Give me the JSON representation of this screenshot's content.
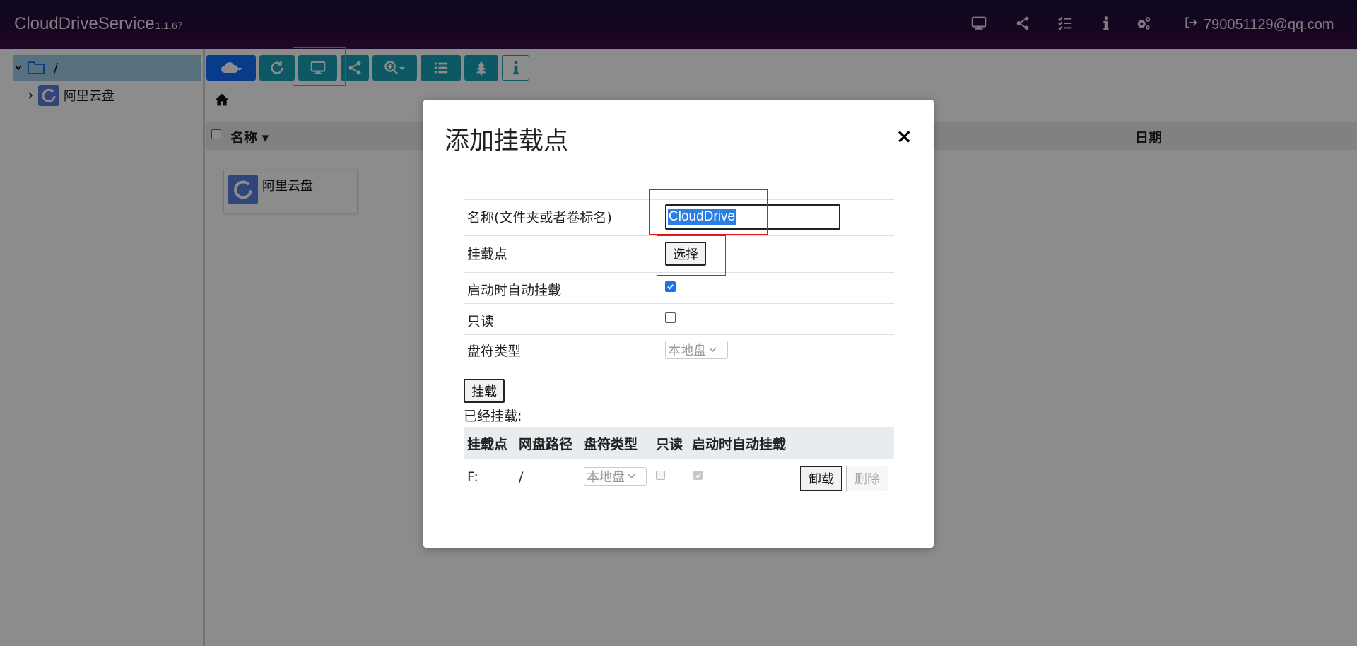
{
  "app": {
    "name": "CloudDriveService",
    "version": "1.1.67",
    "user": "790051129@qq.com"
  },
  "nav_icons": [
    "desktop-icon",
    "share-icon",
    "task-list-icon",
    "info-icon",
    "cogs-icon",
    "sign-out-icon"
  ],
  "sidebar": {
    "root_label": "/",
    "items": [
      {
        "label": "阿里云盘"
      }
    ]
  },
  "toolbar": {
    "buttons": [
      "cloud-dropdown",
      "refresh",
      "mount-desktop",
      "share",
      "zoom-dropdown",
      "list-view",
      "tree",
      "info"
    ]
  },
  "file_list": {
    "col_name": "名称",
    "col_date": "日期",
    "items": [
      {
        "name": "阿里云盘"
      }
    ]
  },
  "modal": {
    "title": "添加挂载点",
    "close": "×",
    "fields": {
      "name_label": "名称(文件夹或者卷标名)",
      "name_value": "CloudDrive",
      "mount_point_label": "挂载点",
      "choose_button": "选择",
      "auto_mount_label": "启动时自动挂载",
      "auto_mount_checked": true,
      "readonly_label": "只读",
      "readonly_checked": false,
      "drive_type_label": "盘符类型",
      "drive_type_value": "本地盘"
    },
    "mount_button": "挂载",
    "mounted_label": "已经挂载:",
    "mounted_table": {
      "headers": [
        "挂载点",
        "网盘路径",
        "盘符类型",
        "只读",
        "启动时自动挂载"
      ],
      "rows": [
        {
          "mount_point": "F:",
          "path": "/",
          "drive_type": "本地盘",
          "readonly": false,
          "auto_mount": true,
          "unmount": "卸载",
          "delete": "删除"
        }
      ]
    }
  },
  "colors": {
    "navbar": "#1a0f3e",
    "toolbar_button": "#17a2b8",
    "primary_button": "#0d6efd",
    "tree_selected": "#9fd0e6",
    "highlight_box": "#e31515",
    "selection": "#2a7fe0"
  }
}
